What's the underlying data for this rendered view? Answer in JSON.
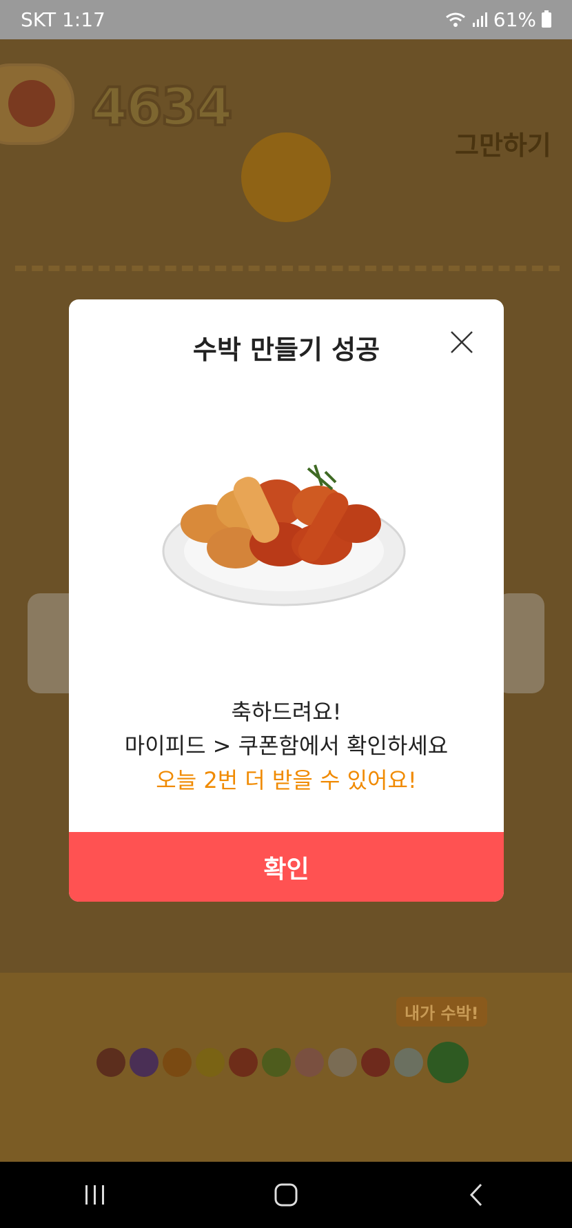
{
  "status_bar": {
    "carrier": "SKT",
    "time": "1:17",
    "battery": "61%"
  },
  "game": {
    "score": "4634",
    "quit_label": "그만하기",
    "tip_badge": "내가 수박!",
    "fruit_lineup_colors": [
      "#d9372a",
      "#8a4fb0",
      "#f29a17",
      "#f0c018",
      "#e8452c",
      "#86b82e",
      "#f5a08e",
      "#f6e6b6",
      "#e0352b",
      "#c9e3b0",
      "#2f8f2f"
    ]
  },
  "modal": {
    "title": "수박 만들기 성공",
    "image_alt": "치킨 쿠폰 이미지",
    "message_line1": "축하드려요!",
    "message_line2": "마이피드 > 쿠폰함에서 확인하세요",
    "message_line3": "오늘 2번 더 받을 수 있어요!",
    "confirm_label": "확인"
  },
  "colors": {
    "confirm": "#ff5252",
    "highlight": "#f08a00"
  },
  "icons": {
    "close": "close-icon",
    "recent": "recent-apps-icon",
    "home": "home-icon",
    "back": "back-icon"
  }
}
